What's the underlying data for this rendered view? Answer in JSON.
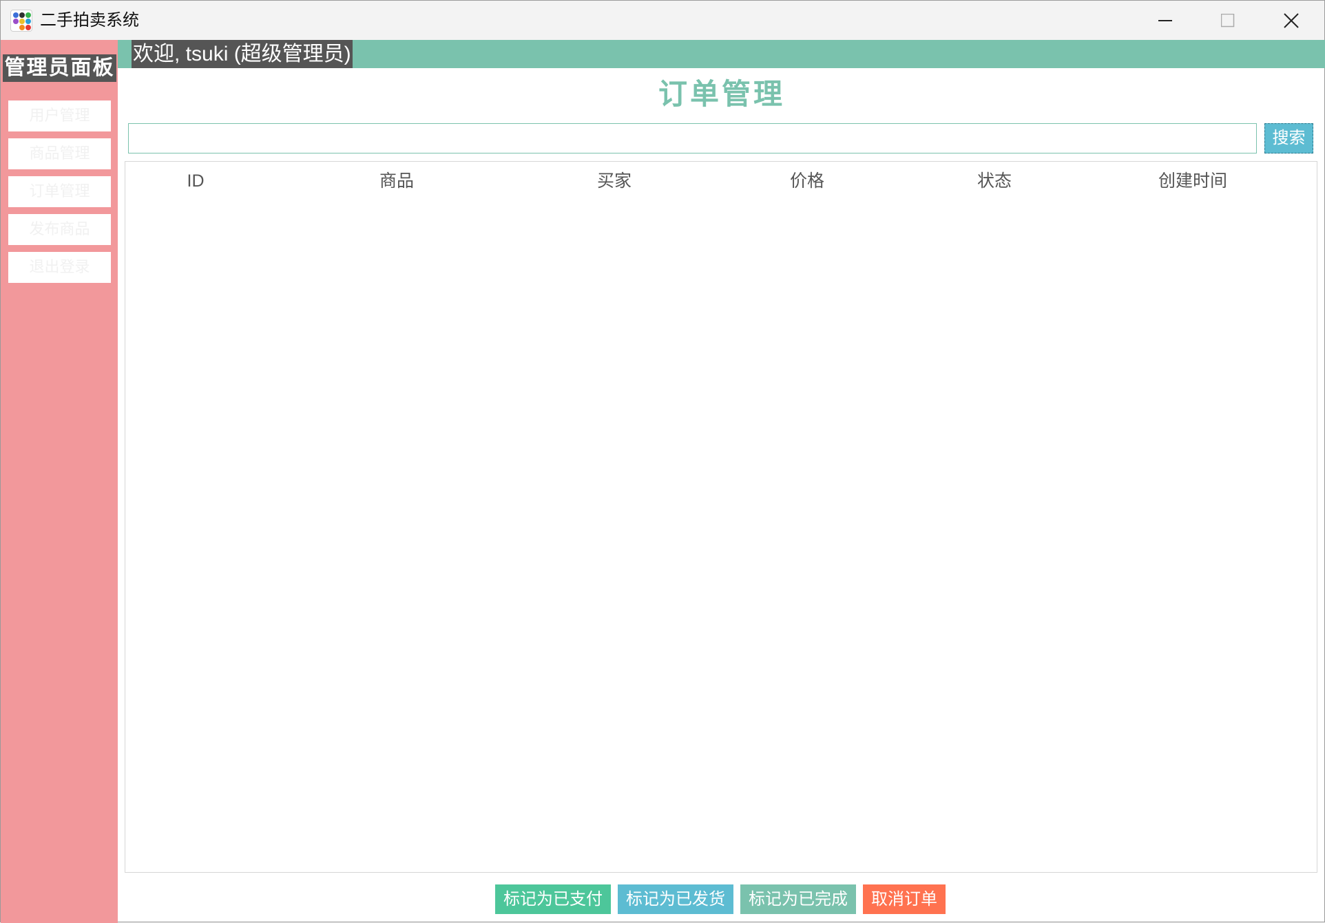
{
  "window": {
    "title": "二手拍卖系统"
  },
  "sidebar": {
    "title": "管理员面板",
    "items": [
      {
        "label": "用户管理"
      },
      {
        "label": "商品管理"
      },
      {
        "label": "订单管理"
      },
      {
        "label": "发布商品"
      },
      {
        "label": "退出登录"
      }
    ]
  },
  "header": {
    "welcome": "欢迎, tsuki (超级管理员)"
  },
  "main": {
    "title": "订单管理",
    "search": {
      "value": "",
      "placeholder": "",
      "button_label": "搜索"
    },
    "table": {
      "columns": [
        "ID",
        "商品",
        "买家",
        "价格",
        "状态",
        "创建时间"
      ],
      "rows": []
    },
    "actions": [
      {
        "label": "标记为已支付",
        "color": "#4dc69a"
      },
      {
        "label": "标记为已发货",
        "color": "#5dbcd2"
      },
      {
        "label": "标记为已完成",
        "color": "#7ac2ad"
      },
      {
        "label": "取消订单",
        "color": "#ff7250"
      }
    ]
  },
  "colors": {
    "sidebar_bg": "#f2989b",
    "accent": "#7ac2ad",
    "search_button": "#5dbcd2",
    "label_bg": "#555555"
  }
}
